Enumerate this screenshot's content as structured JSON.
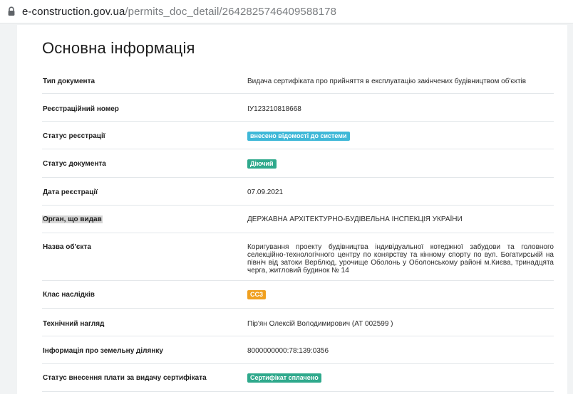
{
  "browser": {
    "url_host": "e-construction.gov.ua",
    "url_path": "/permits_doc_detail/2642825746409588178"
  },
  "section": {
    "title": "Основна інформація"
  },
  "rows": [
    {
      "label": "Тип документа",
      "value": "Видача сертифіката про прийняття в експлуатацію закінчених будівництвом об'єктів"
    },
    {
      "label": "Реєстраційний номер",
      "value": "ІУ123210818668"
    },
    {
      "label": "Статус реєстрації",
      "badge": "внесено відомості до системи",
      "badge_color": "#3fb8d8"
    },
    {
      "label": "Статус документа",
      "badge": "Діючий",
      "badge_color": "#2fa98c"
    },
    {
      "label": "Дата реєстрації",
      "value": "07.09.2021"
    },
    {
      "label": "Орган, що видав",
      "value": "ДЕРЖАВНА АРХІТЕКТУРНО-БУДІВЕЛЬНА ІНСПЕКЦІЯ УКРАЇНИ"
    },
    {
      "label": "Назва об'єкта",
      "value": "Коригування проекту будівництва індивідуальної котеджної забудови та головного селекційно-технологічного центру по конярству та кінному спорту по вул. Богатирській на північ від затоки Верблюд, урочище Оболонь у Оболонському районі м.Києва, тринадцята черга, житловий будинок № 14"
    },
    {
      "label": "Клас наслідків",
      "badge": "СС3",
      "badge_color": "#f0a020"
    },
    {
      "label": "Технічний нагляд",
      "value": "Пір'ян Олексій Володимирович (АТ 002599 )"
    },
    {
      "label": "Інформація про земельну ділянку",
      "value": "8000000000:78:139:0356"
    },
    {
      "label": "Статус внесення плати за видачу сертифіката",
      "badge": "Сертифікат сплачено",
      "badge_color": "#2fa98c"
    }
  ],
  "icons": {
    "lock": "lock-icon"
  }
}
